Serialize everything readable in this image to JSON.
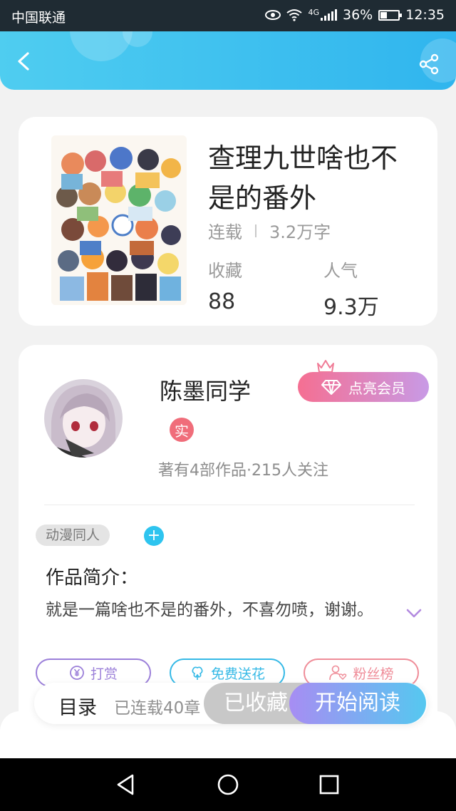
{
  "status_bar": {
    "carrier": "中国联通",
    "network": "4G",
    "battery": "36%",
    "time": "12:35"
  },
  "header": {
    "back_icon": "chevron-left-icon",
    "share_icon": "share-icon",
    "gradient": [
      "#4fcdf0",
      "#30b5ee"
    ]
  },
  "book": {
    "title": "查理九世啥也不是的番外",
    "status": "连载",
    "word_count": "3.2万字",
    "stats": [
      {
        "label": "收藏",
        "value": "88"
      },
      {
        "label": "人气",
        "value": "9.3万"
      }
    ]
  },
  "author": {
    "name": "陈墨同学",
    "verified_badge": "实",
    "works_info": "著有4部作品·215人关注",
    "vip_button": "点亮会员"
  },
  "tags": {
    "items": [
      "动漫同人"
    ],
    "add_label": "+"
  },
  "intro": {
    "heading": "作品简介：",
    "text": "就是一篇啥也不是的番外，不喜勿喷，谢谢。"
  },
  "actions": [
    {
      "label": "打赏",
      "icon": "yen-coin-icon",
      "color": "#9b7fd9"
    },
    {
      "label": "免费送花",
      "icon": "flower-icon",
      "color": "#35b9e6"
    },
    {
      "label": "粉丝榜",
      "icon": "fan-user-icon",
      "color": "#ef8c98"
    }
  ],
  "bottom_bar": {
    "toc_label": "目录",
    "chapter_count": "已连载40章",
    "collected_label": "已收藏",
    "read_label": "开始阅读"
  },
  "nav_bar": {
    "icons": [
      "back-triangle-icon",
      "home-circle-icon",
      "recents-square-icon"
    ]
  }
}
